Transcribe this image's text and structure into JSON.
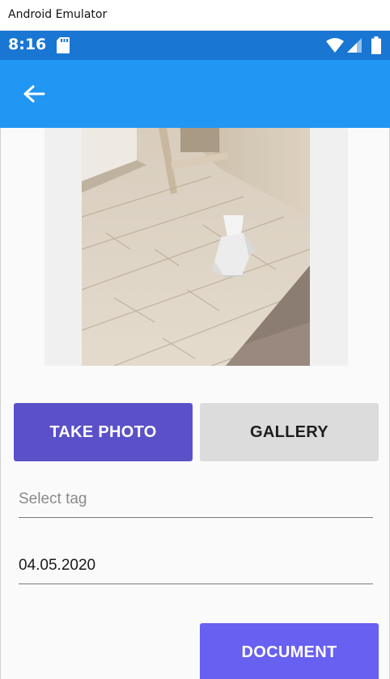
{
  "window": {
    "title": "Android Emulator"
  },
  "status_bar": {
    "time": "8:16",
    "icons": [
      "sd-card-icon",
      "wifi-icon",
      "cell-signal-icon",
      "battery-icon"
    ],
    "background": "#1976d2"
  },
  "toolbar": {
    "back_icon": "arrow-left-icon",
    "background": "#2196f3"
  },
  "photo": {
    "description_visible": false
  },
  "buttons": {
    "take_photo": "TAKE PHOTO",
    "gallery": "GALLERY",
    "document": "DOCUMENT"
  },
  "form": {
    "tag_placeholder": "Select tag",
    "date_value": "04.05.2020"
  },
  "colors": {
    "take_photo_bg": "#5a50c8",
    "gallery_bg": "#dcdcdc",
    "document_bg": "#6860f0"
  }
}
